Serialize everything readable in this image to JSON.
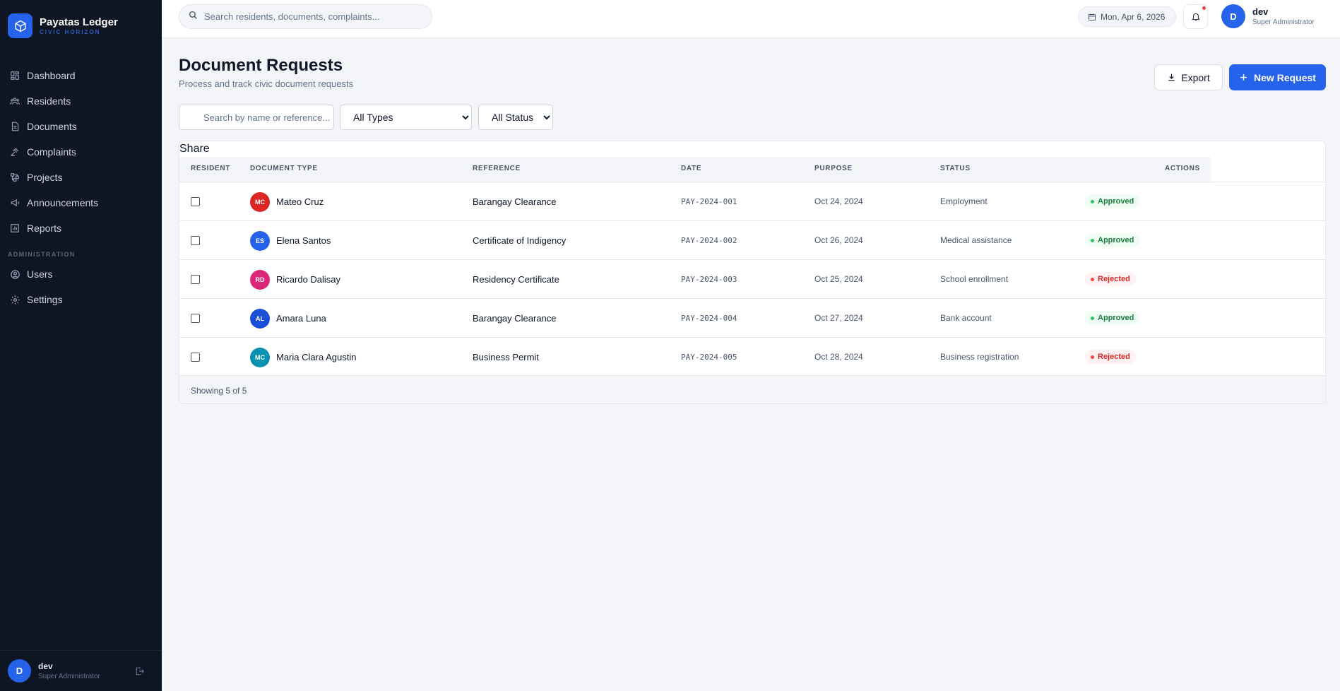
{
  "brand": {
    "title": "Payatas Ledger",
    "subtitle": "CIVIC HORIZON"
  },
  "sidebar": {
    "items": [
      {
        "label": "Dashboard",
        "icon": "dashboard-icon"
      },
      {
        "label": "Residents",
        "icon": "users-icon"
      },
      {
        "label": "Documents",
        "icon": "document-icon"
      },
      {
        "label": "Complaints",
        "icon": "gavel-icon"
      },
      {
        "label": "Projects",
        "icon": "projects-icon"
      },
      {
        "label": "Announcements",
        "icon": "megaphone-icon"
      },
      {
        "label": "Reports",
        "icon": "reports-icon"
      }
    ],
    "section_admin": "ADMINISTRATION",
    "admin_items": [
      {
        "label": "Users",
        "icon": "user-circle-icon"
      },
      {
        "label": "Settings",
        "icon": "gear-icon"
      }
    ],
    "user": {
      "initial": "D",
      "name": "dev",
      "role": "Super Administrator"
    }
  },
  "topbar": {
    "search_placeholder": "Search residents, documents, complaints...",
    "date": "Mon, Apr 6, 2026",
    "user": {
      "initial": "D",
      "name": "dev",
      "role": "Super Administrator"
    }
  },
  "page": {
    "title": "Document Requests",
    "subtitle": "Process and track civic document requests",
    "export_label": "Export",
    "new_label": "New Request"
  },
  "filters": {
    "search_placeholder": "Search by name or reference...",
    "type_selected": "All Types",
    "status_selected": "All Status"
  },
  "table": {
    "share_label": "Share",
    "headers": [
      "RESIDENT",
      "DOCUMENT TYPE",
      "REFERENCE",
      "DATE",
      "PURPOSE",
      "STATUS",
      "ACTIONS"
    ],
    "rows": [
      {
        "initials": "MC",
        "avatar_color": "#dc2626",
        "name": "Mateo Cruz",
        "doc": "Barangay Clearance",
        "ref": "PAY-2024-001",
        "date": "Oct 24, 2024",
        "purpose": "Employment",
        "status": "Approved"
      },
      {
        "initials": "ES",
        "avatar_color": "#2563eb",
        "name": "Elena Santos",
        "doc": "Certificate of Indigency",
        "ref": "PAY-2024-002",
        "date": "Oct 26, 2024",
        "purpose": "Medical assistance",
        "status": "Approved"
      },
      {
        "initials": "RD",
        "avatar_color": "#db2777",
        "name": "Ricardo Dalisay",
        "doc": "Residency Certificate",
        "ref": "PAY-2024-003",
        "date": "Oct 25, 2024",
        "purpose": "School enrollment",
        "status": "Rejected"
      },
      {
        "initials": "AL",
        "avatar_color": "#1d4ed8",
        "name": "Amara Luna",
        "doc": "Barangay Clearance",
        "ref": "PAY-2024-004",
        "date": "Oct 27, 2024",
        "purpose": "Bank account",
        "status": "Approved"
      },
      {
        "initials": "MC",
        "avatar_color": "#0891b2",
        "name": "Maria Clara Agustin",
        "doc": "Business Permit",
        "ref": "PAY-2024-005",
        "date": "Oct 28, 2024",
        "purpose": "Business registration",
        "status": "Rejected"
      }
    ],
    "footer": "Showing 5 of 5"
  },
  "colors": {
    "accent": "#2563eb",
    "sidebar_bg": "#0f1623",
    "approved": "#15803d",
    "rejected": "#dc2626"
  }
}
